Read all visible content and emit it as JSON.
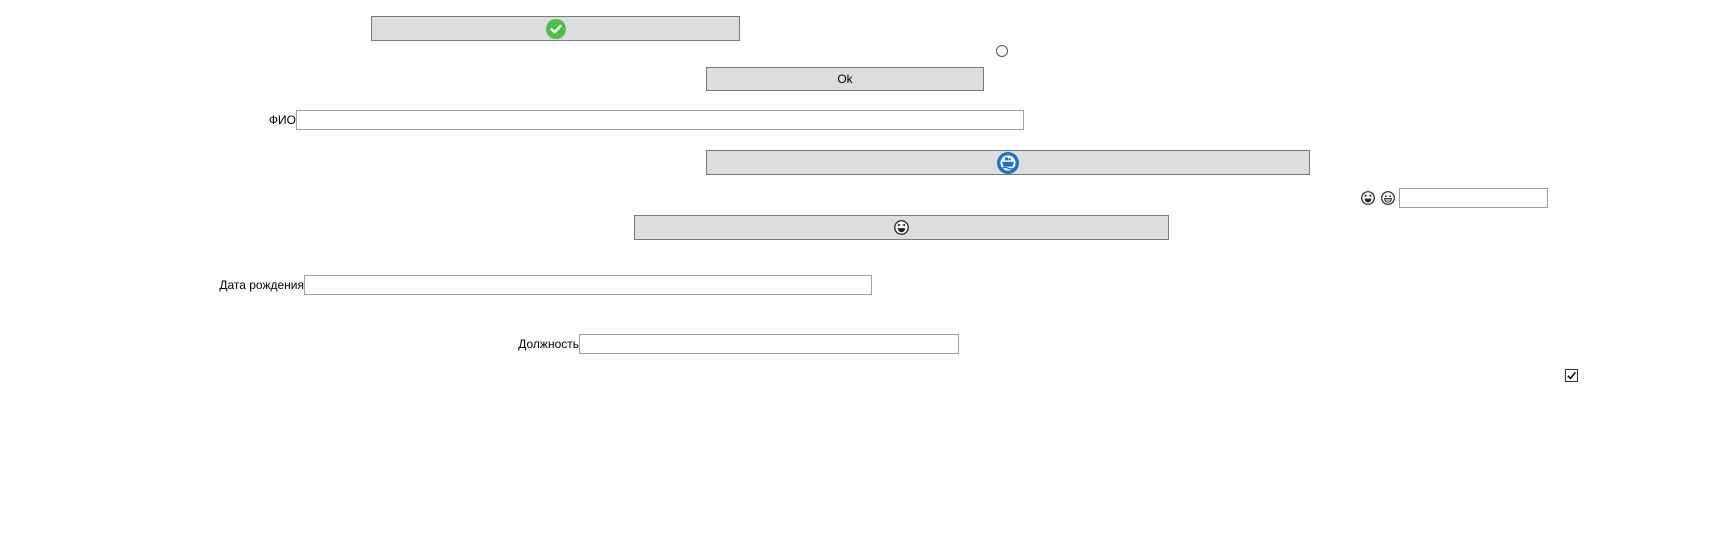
{
  "buttons": {
    "check_button": {
      "icon": "check-circle-icon"
    },
    "ok_button": {
      "label": "Ok"
    },
    "ship_button": {
      "icon": "ship-circle-icon"
    },
    "emoji_button": {
      "icon": "grin-face-icon"
    }
  },
  "fields": {
    "fio": {
      "label": "ФИО",
      "value": ""
    },
    "birth_date": {
      "label": "Дата рождения",
      "value": ""
    },
    "position": {
      "label": "Должность",
      "value": ""
    },
    "small_input": {
      "value": "",
      "icons": [
        "laughing-face-icon",
        "grin-face-icon"
      ]
    }
  },
  "radio": {
    "checked": false
  },
  "checkbox": {
    "checked": true
  },
  "colors": {
    "button_bg": "#dddddd",
    "button_border": "#7a7a7a",
    "field_border": "#a0a0a0",
    "check_icon_green": "#4cc046",
    "ship_icon_blue": "#1a73c8"
  }
}
